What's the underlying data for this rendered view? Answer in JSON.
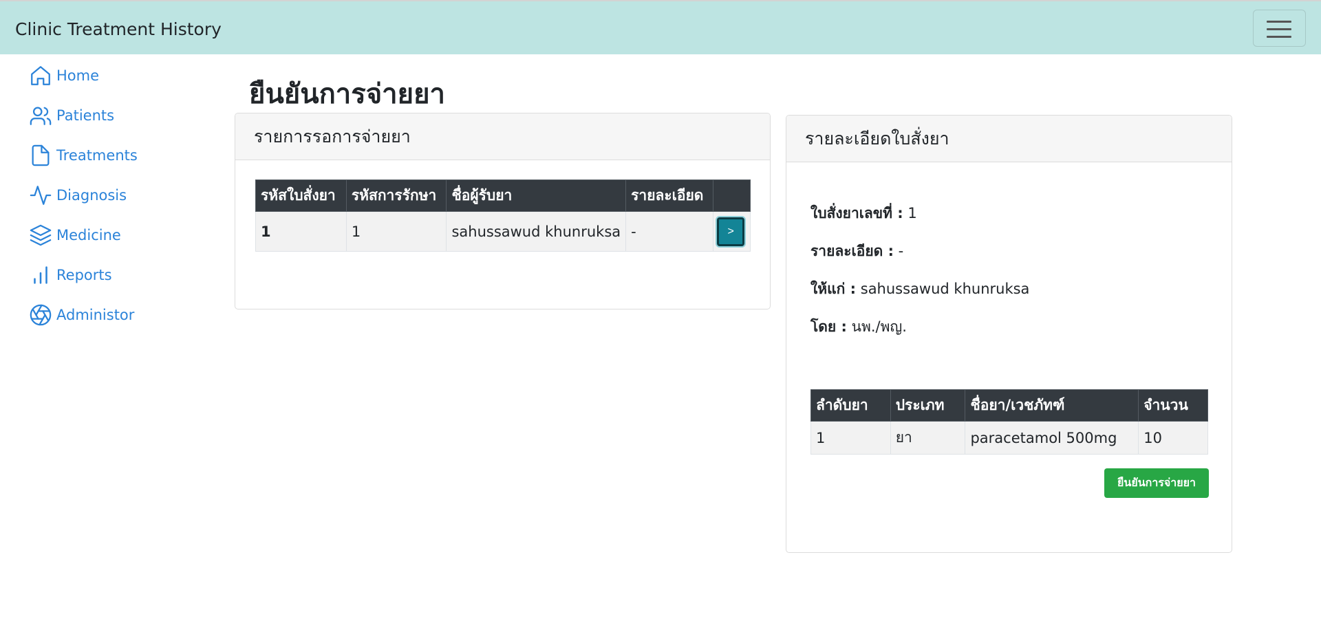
{
  "app": {
    "title": "Clinic Treatment History"
  },
  "sidebar": {
    "items": [
      {
        "label": "Home",
        "icon": "home-icon"
      },
      {
        "label": "Patients",
        "icon": "users-icon"
      },
      {
        "label": "Treatments",
        "icon": "file-icon"
      },
      {
        "label": "Diagnosis",
        "icon": "activity-icon"
      },
      {
        "label": "Medicine",
        "icon": "layers-icon"
      },
      {
        "label": "Reports",
        "icon": "bar-chart-icon"
      },
      {
        "label": "Administor",
        "icon": "aperture-icon"
      }
    ]
  },
  "page": {
    "title": "ยืนยันการจ่ายยา"
  },
  "pending": {
    "header": "รายการรอการจ่ายยา",
    "columns": [
      "รหัสใบสั่งยา",
      "รหัสการรักษา",
      "ชื่อผู้รับยา",
      "รายละเอียด",
      ""
    ],
    "rows": [
      {
        "prescription_id": "1",
        "treatment_id": "1",
        "recipient": "sahussawud khunruksa",
        "detail": "-",
        "action_label": ">"
      }
    ]
  },
  "prescription": {
    "header": "รายละเอียดใบสั่งยา",
    "number_label": "ใบสั่งยาเลขที่ :",
    "number_value": "1",
    "detail_label": "รายละเอียด :",
    "detail_value": "-",
    "to_label": "ให้แก่ :",
    "to_value": "sahussawud khunruksa",
    "by_label": "โดย :",
    "by_value": "นพ./พญ.",
    "columns": [
      "ลำดับยา",
      "ประเภท",
      "ชื่อยา/เวชภัทฑ์",
      "จำนวน"
    ],
    "items": [
      {
        "order": "1",
        "type": "ยา",
        "name": "paracetamol 500mg",
        "qty": "10"
      }
    ],
    "confirm_label": "ยืนยันการจ่ายยา"
  },
  "colors": {
    "navbar": "#bde4e2",
    "link": "#2b83d9",
    "table_header": "#343a40",
    "confirm": "#28a745",
    "action": "#138496"
  }
}
